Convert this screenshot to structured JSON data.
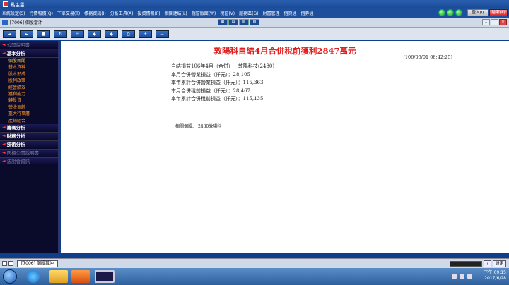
{
  "app": {
    "title": "點金靈"
  },
  "menu": {
    "items": [
      "系統設定(S)",
      "行情報價(Q)",
      "下單交易(T)",
      "帳務資訊(I)",
      "分析工具(A)",
      "投資情報(F)",
      "相關連結(L)",
      "視窗版面(W)",
      "視窗(V)",
      "服務區(G)",
      "財富管理",
      "借貸通",
      "借券通"
    ],
    "login_label": "登入(I)",
    "logout_label": "結束(X)"
  },
  "window": {
    "title": "[7006] 個股當沖"
  },
  "toolbar": {
    "buttons": [
      {
        "name": "back",
        "glyph": "◄"
      },
      {
        "name": "forward",
        "glyph": "►"
      },
      {
        "name": "stop",
        "glyph": "■"
      },
      {
        "name": "refresh",
        "glyph": "↻"
      },
      {
        "name": "list",
        "glyph": "☰"
      },
      {
        "name": "mark",
        "glyph": "◆"
      },
      {
        "name": "mark2",
        "glyph": "◆"
      },
      {
        "name": "print",
        "glyph": "⎙"
      },
      {
        "name": "zoom-in",
        "glyph": "+"
      },
      {
        "name": "zoom-out",
        "glyph": "−"
      }
    ]
  },
  "sidebar": {
    "sections": [
      {
        "label": "公開說明書",
        "dim": true,
        "items": []
      },
      {
        "label": "基本分析",
        "dim": false,
        "items": [
          "個股新聞",
          "基本資料",
          "股本形成",
          "股利政策",
          "經營績效",
          "獲利能力",
          "轉投資",
          "營收盈餘",
          "重大行事曆",
          "產銷組合"
        ]
      },
      {
        "label": "籌碼分析",
        "dim": false,
        "items": []
      },
      {
        "label": "財務分析",
        "dim": false,
        "items": []
      },
      {
        "label": "技術分析",
        "dim": false,
        "items": []
      },
      {
        "label": "興櫃公開說明書",
        "dim": true,
        "items": []
      },
      {
        "label": "法說會資訊",
        "dim": true,
        "items": []
      }
    ]
  },
  "news": {
    "title": "敦陽科自結4月合併稅前獲利2847萬元",
    "time": "(106/06/01 08:42:25)",
    "lines": [
      "自結損益106年4月（合併）－敦陽科技(2480)",
      "本月合併營業損益（仟元）：28,105",
      "本年累計合併營業損益（仟元）：115,363",
      "本月合併稅前損益（仟元）：28,467",
      "本年累計合併稅前損益（仟元）：115,135"
    ],
    "related_label": "．相關個股:",
    "related_value": "2480敦陽科"
  },
  "status": {
    "task_tab": "[7006] 個股當沖",
    "setting_label": "設定"
  },
  "tray": {
    "time": "下午 09:15",
    "date": "2017/6/28"
  },
  "colors": {
    "headline": "#e02020",
    "sidebar_item": "#ff9a2a",
    "sidebar_bg": "#0a0a2a"
  }
}
